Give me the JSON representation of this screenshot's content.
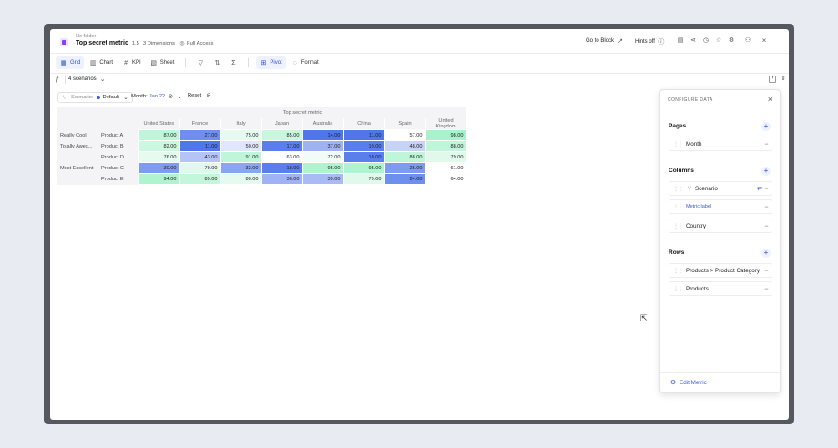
{
  "header": {
    "folder": "No folder",
    "title": "Top secret metric",
    "version": "1.5",
    "dimensions": "3 Dimensions",
    "access": "Full Access",
    "goto_block": "Go to Block",
    "hints": "Hints off"
  },
  "toolbar": {
    "grid": "Grid",
    "chart": "Chart",
    "kpi": "KPI",
    "sheet": "Sheet",
    "pivot": "Pivot",
    "format": "Format"
  },
  "formula": {
    "fx": "f",
    "selector": "4 scenarios"
  },
  "filters": {
    "scenario_label": "Scenario:",
    "scenario_value": "Default",
    "month_label": "Month:",
    "month_value": "Jan 22",
    "reset": "Reset"
  },
  "colors": {
    "accent": "#3b5bdb",
    "brand": "#8a3ffc"
  },
  "grid": {
    "metric": "Top secret metric",
    "columns": [
      "United States",
      "France",
      "Italy",
      "Japan",
      "Australia",
      "China",
      "Spain",
      "United Kingdom"
    ],
    "rows": [
      {
        "group": "Really Cool",
        "product": "Product A",
        "values": [
          "87.00",
          "27.00",
          "75.00",
          "85.00",
          "14.00",
          "11.00",
          "57.00",
          "98.00"
        ],
        "colors": [
          "#bff5d8",
          "#6d8ff0",
          "#e6fbef",
          "#c9f7de",
          "#4f76ea",
          "#4f76ea",
          "#ffffff",
          "#a9f2cb"
        ]
      },
      {
        "group": "Totally Awes...",
        "product": "Product B",
        "values": [
          "82.00",
          "11.00",
          "50.00",
          "17.00",
          "37.00",
          "19.00",
          "48.00",
          "88.00"
        ],
        "colors": [
          "#ccf8e0",
          "#4f76ea",
          "#e0e6fb",
          "#5a7fec",
          "#9fb3f4",
          "#5a7fec",
          "#c7d2f7",
          "#bff5d8"
        ]
      },
      {
        "group": "",
        "product": "Product D",
        "values": [
          "76.00",
          "43.00",
          "91.00",
          "63.00",
          "72.00",
          "18.00",
          "88.00",
          "79.00"
        ],
        "colors": [
          "#e6fbef",
          "#b5c4f6",
          "#bff5d8",
          "#ffffff",
          "#f2fcf6",
          "#5a7fec",
          "#bff5d8",
          "#e0f9eb"
        ]
      },
      {
        "group": "Most Excellent",
        "product": "Product C",
        "values": [
          "30.00",
          "79.00",
          "32.00",
          "18.00",
          "95.00",
          "95.00",
          "25.00",
          "61.00"
        ],
        "colors": [
          "#7d9cf1",
          "#e0f9eb",
          "#8aa6f2",
          "#5a7fec",
          "#b0f3cf",
          "#b0f3cf",
          "#7d9cf1",
          "#ffffff"
        ]
      },
      {
        "group": "",
        "product": "Product E",
        "values": [
          "94.00",
          "89.00",
          "80.00",
          "36.00",
          "39.00",
          "79.00",
          "24.00",
          "64.00"
        ],
        "colors": [
          "#b0f3cf",
          "#c3f6da",
          "#e6fbef",
          "#9fb3f4",
          "#a8bbf5",
          "#e0f9eb",
          "#6d8ff0",
          "#ffffff"
        ]
      }
    ]
  },
  "config": {
    "title": "CONFIGURE DATA",
    "pages_label": "Pages",
    "pages": [
      "Month"
    ],
    "columns_label": "Columns",
    "columns": [
      "Scenario",
      "Metric label",
      "Country"
    ],
    "rows_label": "Rows",
    "rows": [
      "Products > Product Category",
      "Products"
    ],
    "edit_metric": "Edit Metric"
  }
}
